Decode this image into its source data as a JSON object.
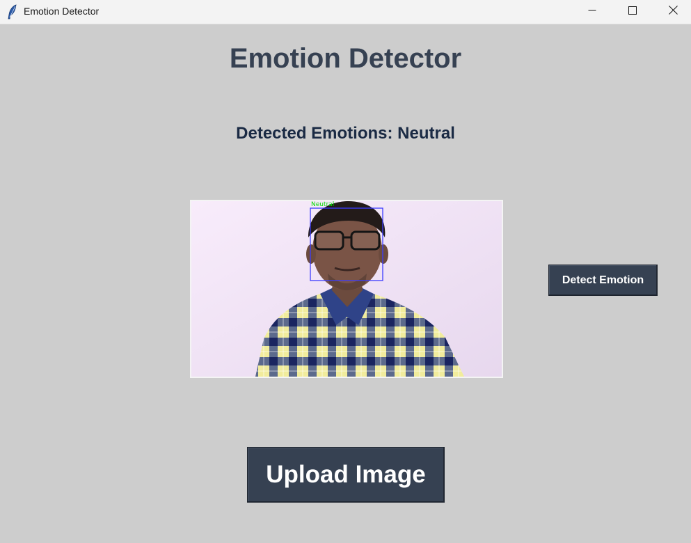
{
  "window": {
    "title": "Emotion Detector",
    "icon": "feather-icon",
    "controls": [
      "minimize-icon",
      "maximize-icon",
      "close-icon"
    ]
  },
  "main": {
    "heading": "Emotion Detector",
    "result_text": "Detected Emotions: Neutral",
    "image": {
      "face_box_label": "Neutral",
      "face_box_color": "#3c3cff",
      "face_label_color": "#00dd00"
    }
  },
  "buttons": {
    "detect_label": "Detect Emotion",
    "upload_label": "Upload Image"
  },
  "colors": {
    "background": "#cdcdcd",
    "button_bg": "#364152",
    "heading": "#364152",
    "result_text": "#1a2a44"
  }
}
